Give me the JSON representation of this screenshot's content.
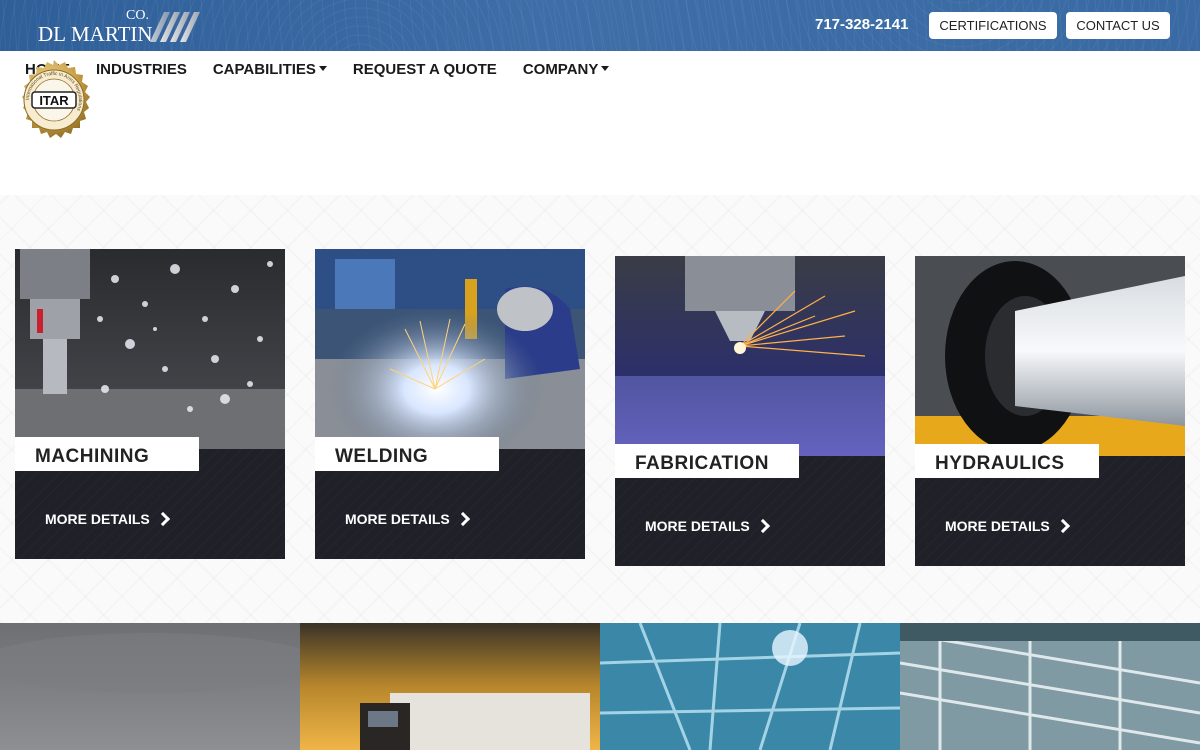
{
  "header": {
    "logo": {
      "dl": "DL",
      "martin": "MARTIN",
      "co": "CO."
    },
    "phone": "717-328-2141",
    "certifications_label": "CERTIFICATIONS",
    "contact_label": "CONTACT US"
  },
  "nav": {
    "items": [
      {
        "label": "HOME",
        "dropdown": false
      },
      {
        "label": "INDUSTRIES",
        "dropdown": false
      },
      {
        "label": "CAPABILITIES",
        "dropdown": true
      },
      {
        "label": "REQUEST A QUOTE",
        "dropdown": false
      },
      {
        "label": "COMPANY",
        "dropdown": true
      }
    ]
  },
  "seal": {
    "text": "ITAR",
    "ring_text": "International Traffic in Arms Regulations"
  },
  "cards": [
    {
      "title": "MACHINING",
      "more": "MORE DETAILS"
    },
    {
      "title": "WELDING",
      "more": "MORE DETAILS"
    },
    {
      "title": "FABRICATION",
      "more": "MORE DETAILS"
    },
    {
      "title": "HYDRAULICS",
      "more": "MORE DETAILS"
    }
  ],
  "colors": {
    "header_blue": "#3a6aa3",
    "card_dark": "#202029",
    "gold": "#c9a14a"
  },
  "icons": {
    "more": "chevron-right-icon",
    "dropdown": "caret-down-icon"
  }
}
